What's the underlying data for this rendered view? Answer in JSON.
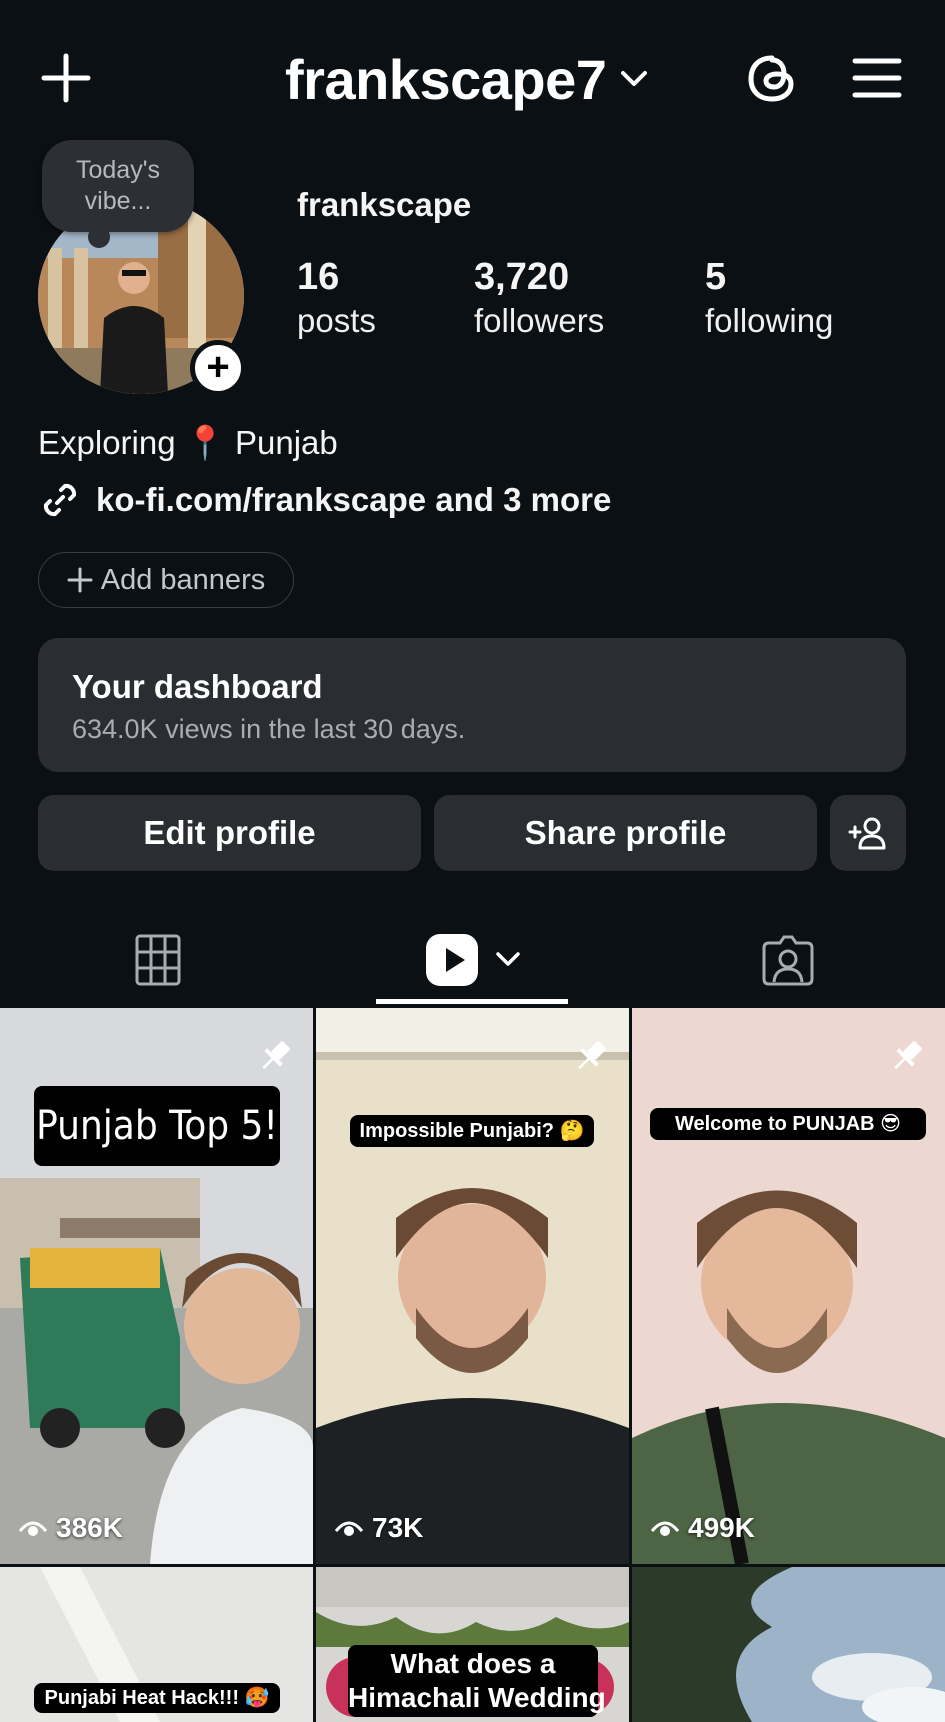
{
  "header": {
    "username": "frankscape7"
  },
  "profile": {
    "note": "Today's vibe...",
    "display_name": "frankscape",
    "stats": [
      {
        "value": "16",
        "label": "posts"
      },
      {
        "value": "3,720",
        "label": "followers"
      },
      {
        "value": "5",
        "label": "following"
      }
    ],
    "bio": "Exploring 📍 Punjab",
    "link": "ko-fi.com/frankscape and 3 more",
    "add_banners": "Add banners"
  },
  "dashboard": {
    "title": "Your dashboard",
    "subtitle": "634.0K views in the last 30 days."
  },
  "actions": {
    "edit": "Edit profile",
    "share": "Share profile"
  },
  "grid": [
    {
      "caption": "Punjab Top 5!",
      "views": "386K",
      "pinned": true
    },
    {
      "caption": "Impossible Punjabi? 🤔",
      "views": "73K",
      "pinned": true
    },
    {
      "caption": "Welcome to PUNJAB 😎",
      "views": "499K",
      "pinned": true
    },
    {
      "caption": "Punjabi Heat Hack!!! 🥵"
    },
    {
      "caption_line1": "What does a",
      "caption_line2": "Himachali Wedding"
    },
    {}
  ],
  "colors": {
    "background": "#0b1014",
    "card": "#2a2d32",
    "text": "#f5f5f5",
    "muted": "#a9adb2"
  }
}
